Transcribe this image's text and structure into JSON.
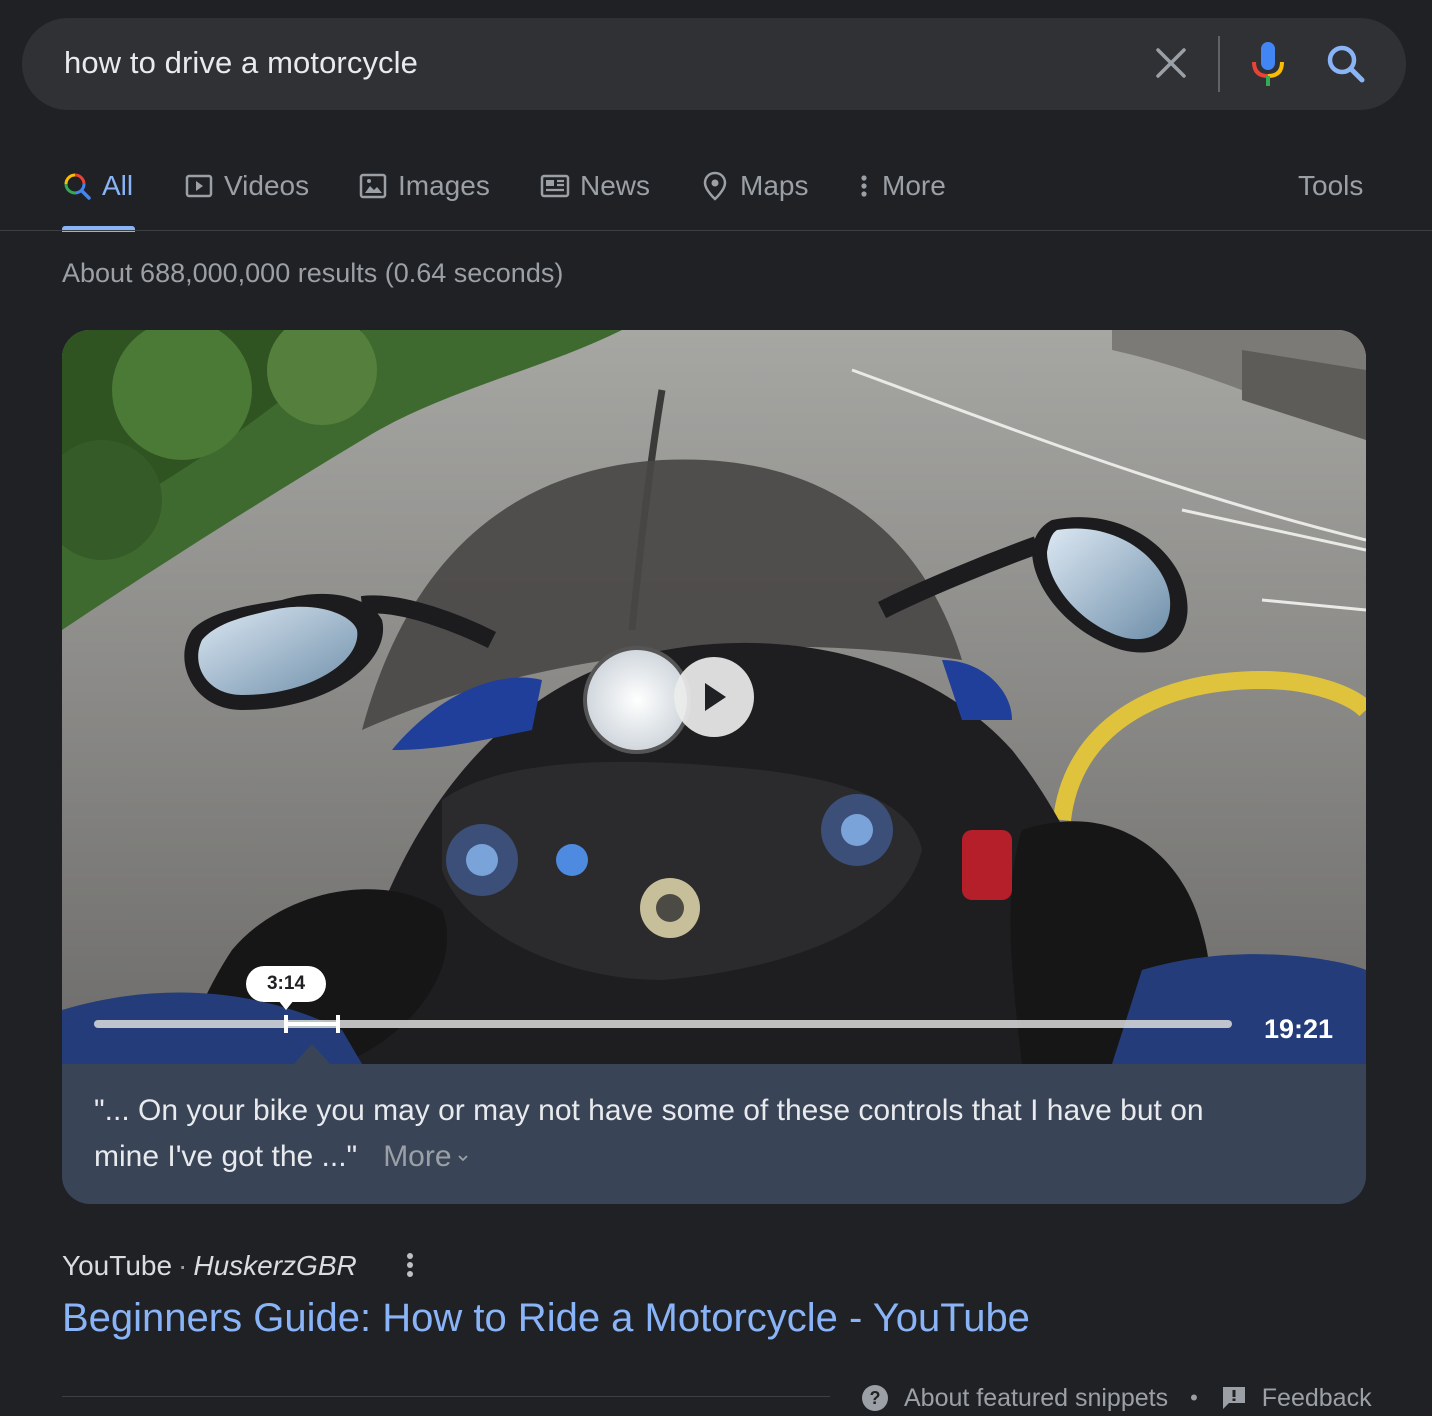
{
  "search": {
    "query": "how to drive a motorcycle"
  },
  "tabs": [
    {
      "label": "All",
      "icon": "search-multicolor-icon",
      "active": true
    },
    {
      "label": "Videos",
      "icon": "video-icon"
    },
    {
      "label": "Images",
      "icon": "image-icon"
    },
    {
      "label": "News",
      "icon": "news-icon"
    },
    {
      "label": "Maps",
      "icon": "map-pin-icon"
    },
    {
      "label": "More",
      "icon": "vertical-dots-icon"
    }
  ],
  "tools_label": "Tools",
  "stats": "About 688,000,000 results (0.64 seconds)",
  "video": {
    "clip_time": "3:14",
    "duration": "19:21",
    "snippet_line1": "\"... On your bike you may or may not have some of these controls that I have but on",
    "snippet_line2": "mine I've got the ...\"",
    "more_label": "More"
  },
  "result": {
    "site": "YouTube",
    "separator": "·",
    "author": "HuskerzGBR",
    "title": "Beginners Guide: How to Ride a Motorcycle - YouTube"
  },
  "footer": {
    "about_label": "About featured snippets",
    "bullet": "•",
    "feedback_label": "Feedback"
  },
  "colors": {
    "background": "#202124",
    "accent": "#8ab4f8",
    "snippet_bg": "#394457"
  }
}
